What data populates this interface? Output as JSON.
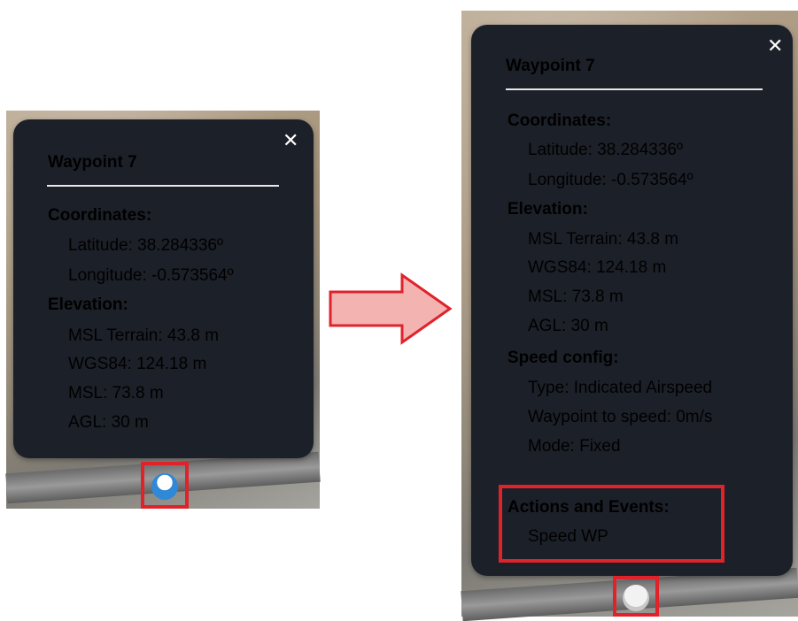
{
  "left_popup": {
    "title": "Waypoint 7",
    "close": "✕",
    "coordinates_label": "Coordinates:",
    "latitude": "Latitude: 38.284336º",
    "longitude": "Longitude: -0.573564º",
    "elevation_label": "Elevation:",
    "msl_terrain": "MSL Terrain: 43.8 m",
    "wgs84": "WGS84: 124.18 m",
    "msl": "MSL: 73.8 m",
    "agl": "AGL: 30 m"
  },
  "right_popup": {
    "title": "Waypoint 7",
    "close": "✕",
    "coordinates_label": "Coordinates:",
    "latitude": "Latitude: 38.284336º",
    "longitude": "Longitude: -0.573564º",
    "elevation_label": "Elevation:",
    "msl_terrain": "MSL Terrain: 43.8 m",
    "wgs84": "WGS84: 124.18 m",
    "msl": "MSL: 73.8 m",
    "agl": "AGL: 30 m",
    "speed_config_label": "Speed config:",
    "type": "Type: Indicated Airspeed",
    "waypoint_to_speed": "Waypoint to speed: 0m/s",
    "mode": "Mode: Fixed",
    "actions_label": "Actions and Events:",
    "action_item": "Speed WP"
  },
  "icons": {
    "arrow": "right-arrow-icon",
    "marker_left": "waypoint-marker-icon",
    "marker_right": "waypoint-marker-icon"
  },
  "colors": {
    "popup_bg": "#1c2028",
    "highlight": "#e0222b",
    "arrow_fill": "#f2b3b1",
    "arrow_stroke": "#e0222b",
    "marker_blue": "#2f88d8"
  }
}
